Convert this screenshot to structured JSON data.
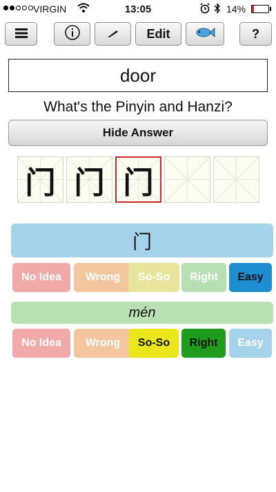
{
  "status": {
    "carrier": "VIRGIN",
    "time": "13:05",
    "battery": "14%",
    "battery_level": 0.14
  },
  "toolbar": {
    "menu_icon": "hamburger-menu-icon",
    "info_icon": "info-icon",
    "pen_icon": "pen-icon",
    "edit_label": "Edit",
    "fish_icon": "fish-icon",
    "help_label": "?"
  },
  "card": {
    "word": "door",
    "question": "What's the Pinyin and Hanzi?",
    "hide_answer_label": "Hide Answer"
  },
  "writing_grid": {
    "cells_total": 5,
    "filled_cells": 3,
    "selected_cell": 3,
    "stroke_glyph": "门"
  },
  "answer": {
    "hanzi": "门",
    "pinyin": "mén"
  },
  "ratings": {
    "hanzi_row": [
      {
        "label": "No Idea",
        "color": "#f1a9a9"
      },
      {
        "label": "Wrong",
        "color": "#f4c69d"
      },
      {
        "label": "So-So",
        "color": "#e7e49c"
      },
      {
        "label": "Right",
        "color": "#b6e0b3"
      },
      {
        "label": "Easy",
        "color": "#1f8ed0",
        "selected": true
      }
    ],
    "pinyin_row": [
      {
        "label": "No Idea",
        "color": "#f1a9a9"
      },
      {
        "label": "Wrong",
        "color": "#f4c69d"
      },
      {
        "label": "So-So",
        "color": "#eae61b",
        "selected": true
      },
      {
        "label": "Right",
        "color": "#1f9c1c",
        "selected": true
      },
      {
        "label": "Easy",
        "color": "#a6d3ec"
      }
    ]
  },
  "colors": {
    "selected_cell_border": "#c92a2a",
    "hanzi_bar": "#a6d3ec",
    "pinyin_bar": "#b9e0b2"
  }
}
